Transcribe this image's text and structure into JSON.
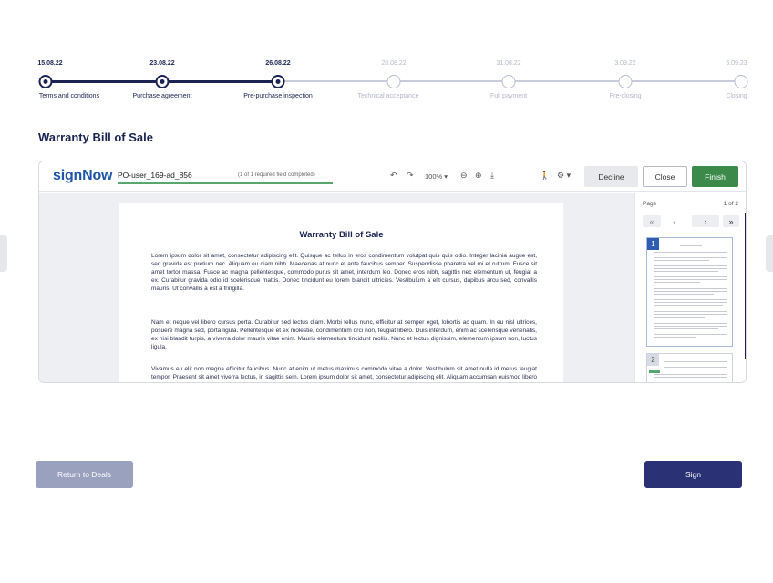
{
  "timeline": {
    "steps": [
      {
        "date": "15.08.22",
        "label": "Terms and conditions",
        "done": true
      },
      {
        "date": "23.08.22",
        "label": "Purchase agreement",
        "done": true
      },
      {
        "date": "26.08.22",
        "label": "Pre-purchase inspection",
        "done": true
      },
      {
        "date": "28.08.22",
        "label": "Technical acceptance",
        "done": false
      },
      {
        "date": "31.08.22",
        "label": "Full payment",
        "done": false
      },
      {
        "date": "3.09.22",
        "label": "Pre-closing",
        "done": false
      },
      {
        "date": "5.09.23",
        "label": "Closing",
        "done": false
      }
    ]
  },
  "page": {
    "title": "Warranty Bill of Sale"
  },
  "viewer": {
    "brand": "signNow",
    "document_name": "PO-user_169-ad_856",
    "field_status": "(1 of 1 required field completed)",
    "zoom": "100%",
    "buttons": {
      "decline": "Decline",
      "close": "Close",
      "finish": "Finish"
    },
    "icons": [
      "undo-icon",
      "redo-icon",
      "zoom-out-icon",
      "zoom-in-icon",
      "download-icon",
      "accessibility-icon",
      "settings-icon"
    ],
    "sidebar": {
      "page_label": "Page",
      "page_count": "1 of 2",
      "thumbnails": [
        "1",
        "2"
      ]
    },
    "document": {
      "title": "Warranty Bill of Sale",
      "paragraphs": [
        "Lorem ipsum dolor sit amet, consectetur adipiscing elit. Quisque ac tellus in eros condimentum volutpat quis quis odio. Integer lacinia augue est, sed gravida est pretium nec. Aliquam eu diam nibh. Maecenas at nunc et ante faucibus semper. Suspendisse pharetra vel mi et rutrum. Fusce sit amet tortor massa. Fusce ac magna pellentesque, commodo purus sit amet, interdum leo. Donec eros nibh, sagittis nec elementum ut, feugiat a ex. Curabitur gravida odio id scelerisque mattis. Donec tincidunt eu lorem blandit ultricies. Vestibulum a elit cursus, dapibus arcu sed, convallis mauris. Ut convallis a est a fringilla.",
        "Nam et neque vel libero cursus porta. Curabitur sed lectus diam. Morbi tellus nunc, efficitur at semper eget, lobortis ac quam. In eu nisl ultrices, posuere magna sed, porta ligula. Pellentesque et ex molestie, condimentum orci non, feugiat libero. Duis interdum, enim ac scelerisque venenatis, ex nisi blandit turpis, a viverra dolor mauris vitae enim. Mauris elementum tincidunt mollis. Nunc et lectus dignissim, elementum ipsum non, luctus ligula.",
        "Vivamus eu elit non magna efficitur faucibus. Nunc at enim ut metus maximus commodo vitae a dolor. Vestibulum sit amet nulla id metus feugiat tempor. Praesent sit amet viverra lectus, in sagittis sem. Lorem ipsum dolor sit amet, consectetur adipiscing elit. Aliquam accumsan euismod libero eget fermentum. Nullam pharetra elementum"
      ]
    }
  },
  "actions": {
    "return_label": "Return to Deals",
    "sign_label": "Sign"
  },
  "colors": {
    "navy": "#1a2352",
    "finish_green": "#3b8a4a",
    "sign_button": "#2a3275",
    "return_button": "#9aa1bf",
    "brand_blue": "#1f55a8"
  }
}
